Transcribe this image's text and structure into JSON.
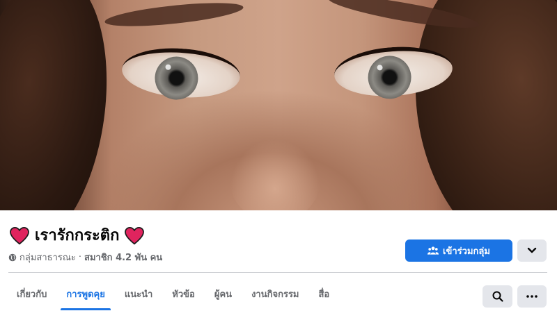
{
  "cover": {
    "alt": ""
  },
  "group": {
    "title": "เรารักกระติก",
    "privacy": "กลุ่มสาธารณะ",
    "separator": "·",
    "members": "สมาชิก 4.2 พัน คน"
  },
  "actions": {
    "join_label": "เข้าร่วมกลุ่ม"
  },
  "tabs": [
    {
      "label": "เกี่ยวกับ"
    },
    {
      "label": "การพูดคุย"
    },
    {
      "label": "แนะนำ"
    },
    {
      "label": "หัวข้อ"
    },
    {
      "label": "ผู้คน"
    },
    {
      "label": "งานกิจกรรม"
    },
    {
      "label": "สื่อ"
    }
  ],
  "colors": {
    "accent": "#1b74e4",
    "heart": "#e0245e",
    "secondary_bg": "#e4e6eb",
    "muted_text": "#65676b"
  },
  "icons": {
    "title_prefix": "heart-icon",
    "title_suffix": "heart-icon",
    "privacy": "globe-icon",
    "join": "group-icon",
    "dropdown": "chevron-down-icon",
    "search": "search-icon",
    "more": "more-icon"
  }
}
